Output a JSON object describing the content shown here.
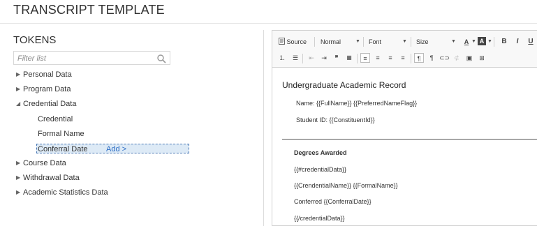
{
  "page_title": "TRANSCRIPT TEMPLATE",
  "tokens": {
    "title": "TOKENS",
    "filter_placeholder": "Filter list",
    "items": [
      {
        "label": "Personal Data",
        "expanded": false
      },
      {
        "label": "Program Data",
        "expanded": false
      },
      {
        "label": "Credential Data",
        "expanded": true,
        "children": [
          "Credential",
          "Formal Name",
          "Conferral Date"
        ]
      },
      {
        "label": "Course Data",
        "expanded": false
      },
      {
        "label": "Withdrawal Data",
        "expanded": false
      },
      {
        "label": "Academic Statistics Data",
        "expanded": false
      }
    ],
    "selected_child": "Conferral Date",
    "add_label": "Add >"
  },
  "toolbar": {
    "source_label": "Source",
    "format_value": "Normal",
    "font_value": "Font",
    "size_value": "Size",
    "bold": "B",
    "italic": "I",
    "underline": "U"
  },
  "document": {
    "title": "Undergraduate Academic Record",
    "name_line": "Name: {{FullName}} {{PreferredNameFlag}}",
    "student_id_line": "Student ID: {{ConstituentId}}",
    "degrees_heading": "Degrees Awarded",
    "lines": [
      "{{#credentialData}}",
      "{{CrendentialName}} {{FormalName}}",
      "Conferred {{ConferralDate}}",
      "{{/credentialData}}"
    ]
  }
}
